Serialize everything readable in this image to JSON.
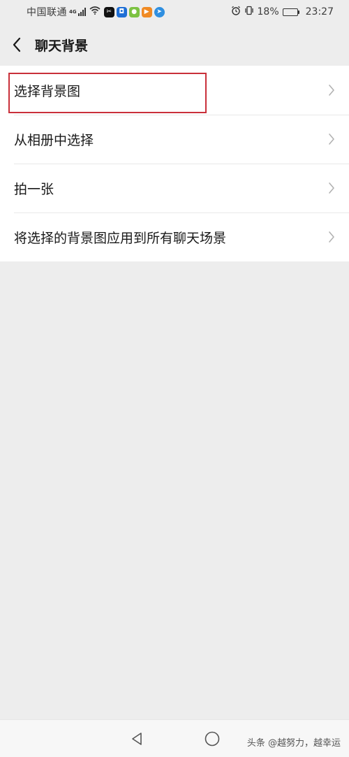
{
  "status_bar": {
    "carrier": "中国联通",
    "network_type": "4G",
    "battery_percent_text": "18%",
    "battery_level": 0.18,
    "time": "23:27",
    "icons": [
      "signal-icon",
      "wifi-icon",
      "capcut-icon",
      "shield-app-icon",
      "green-app-icon",
      "orange-play-icon",
      "blue-app-icon",
      "alarm-icon",
      "vibrate-icon",
      "battery-icon"
    ]
  },
  "nav": {
    "title": "聊天背景",
    "back_icon": "back-arrow-icon"
  },
  "menu": {
    "items": [
      {
        "label": "选择背景图"
      },
      {
        "label": "从相册中选择"
      },
      {
        "label": "拍一张"
      },
      {
        "label": "将选择的背景图应用到所有聊天场景"
      }
    ],
    "chevron_icon": "chevron-right-icon"
  },
  "colors": {
    "background": "#ededed",
    "highlight": "#c9303a",
    "battery_fill": "#f5a623"
  },
  "system_nav": {
    "icons": [
      "back-triangle-icon",
      "home-circle-icon"
    ]
  },
  "watermark": "头条 @越努力，越幸运"
}
